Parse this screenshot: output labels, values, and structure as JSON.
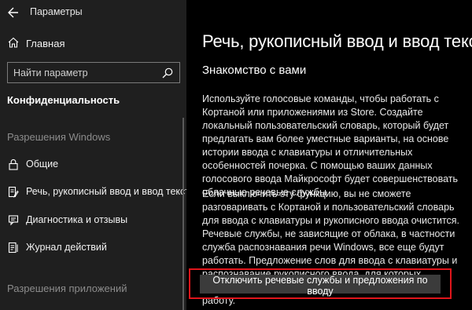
{
  "window": {
    "title": "Параметры"
  },
  "sidebar": {
    "home_label": "Главная",
    "search_placeholder": "Найти параметр",
    "section_title": "Конфиденциальность",
    "group_windows": "Разрешения Windows",
    "items": [
      {
        "label": "Общие",
        "icon": "lock-icon"
      },
      {
        "label": "Речь, рукописный ввод и ввод текста",
        "icon": "document-pen-icon"
      },
      {
        "label": "Диагностика и отзывы",
        "icon": "feedback-icon"
      },
      {
        "label": "Журнал действий",
        "icon": "history-icon"
      }
    ],
    "group_apps": "Разрешения приложений"
  },
  "main": {
    "title": "Речь, рукописный ввод и ввод текста",
    "subtitle": "Знакомство с вами",
    "paragraph1": "Используйте голосовые команды, чтобы работать с Кортаной или приложениями из Store. Создайте локальный пользовательский словарь, который будет предлагать вам более уместные варианты, на основе истории ввода с клавиатуры и отличительных особенностей почерка. С помощью ваших данных голосового ввода Майкрософт будет совершенствовать облачные речевые службы.",
    "paragraph2": "Если выключить эту функцию, вы не сможете разговаривать с Кортаной и пользовательский словарь для ввода с клавиатуры и рукописного ввода очистится. Речевые службы, не зависящие от облака, в частности служба распознавания речи Windows, все еще будут работать. Предложение слов для ввода с клавиатуры и распознавание рукописного ввода, для которых используется системный словарь, также продолжат работу.",
    "button_label": "Отключить речевые службы и предложения по вводу"
  },
  "colors": {
    "highlight_frame": "#e0151b",
    "sidebar_bg": "#1f1f1f",
    "main_bg": "#000000",
    "button_bg": "#3b3b3b"
  }
}
